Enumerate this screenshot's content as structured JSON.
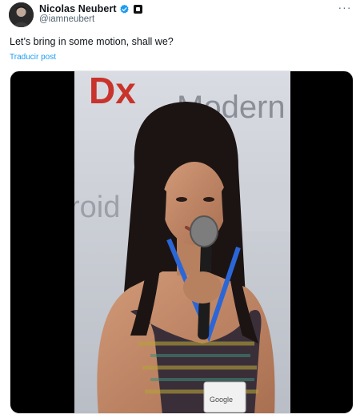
{
  "author": {
    "display_name": "Nicolas Neubert",
    "handle": "@iamneubert",
    "verified": true,
    "avatar_icon": "avatar-portrait",
    "verified_icon": "verified-check-icon",
    "badge_icon": "affiliation-badge-icon"
  },
  "tweet": {
    "text": "Let’s bring in some motion, shall we?",
    "translate_label": "Traducir post"
  },
  "media": {
    "type": "video",
    "background_sign_text": "Dx",
    "background_sign_text_2": "Modern",
    "background_sign_text_3": "roid",
    "badge_text": "Google"
  },
  "colors": {
    "accent": "#1d9bf0",
    "secondary_text": "#536471",
    "primary_text": "#0f1419"
  },
  "actions": {
    "more_icon": "more-horizontal-icon"
  }
}
